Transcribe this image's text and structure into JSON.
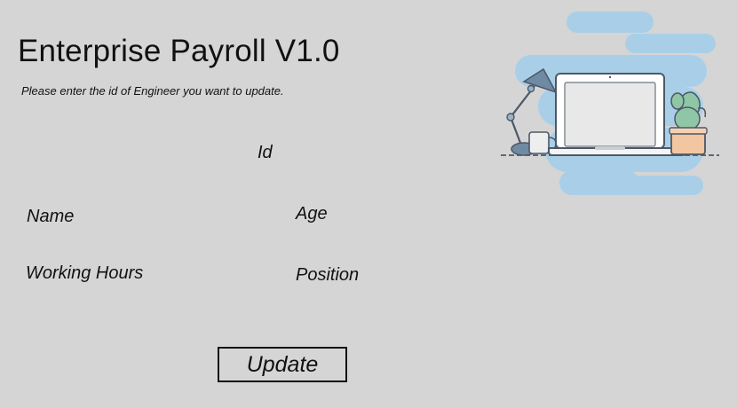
{
  "app": {
    "title": "Enterprise Payroll V1.0",
    "instruction": "Please enter the id of Engineer you want to update."
  },
  "form": {
    "id_label": "Id",
    "name_label": "Name",
    "age_label": "Age",
    "working_hours_label": "Working Hours",
    "position_label": "Position"
  },
  "actions": {
    "update_label": "Update"
  },
  "illustration": {
    "name": "workspace-laptop-illustration",
    "colors": {
      "background_blob": "#a9cfe8",
      "laptop_frame": "#ffffff",
      "outline": "#4d5866",
      "lamp": "#6f8aa3",
      "cactus": "#8fc6a6",
      "pot": "#f1c6a0"
    }
  },
  "colors": {
    "page_background": "#d5d5d5",
    "text": "#111111"
  }
}
